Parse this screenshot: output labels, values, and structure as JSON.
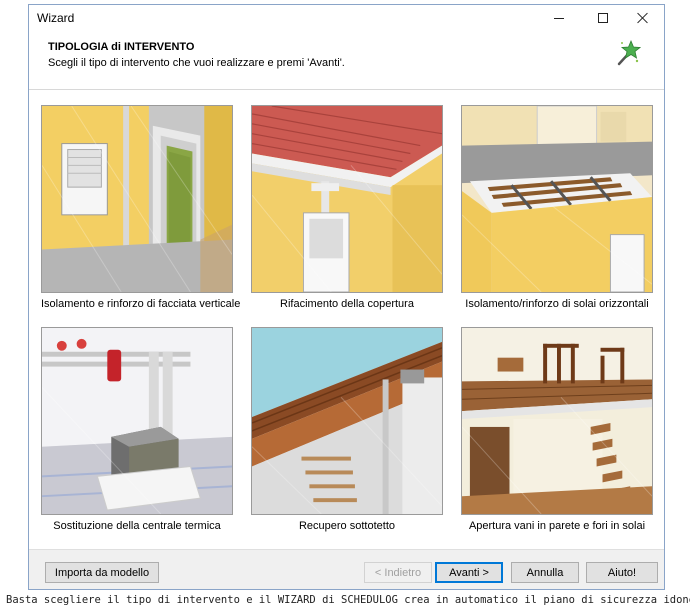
{
  "window": {
    "title": "Wizard"
  },
  "header": {
    "title": "TIPOLOGIA di INTERVENTO",
    "subtitle": "Scegli il tipo di intervento che vuoi realizzare e premi 'Avanti'."
  },
  "options": [
    {
      "label": "Isolamento e rinforzo di facciata verticale"
    },
    {
      "label": "Rifacimento della copertura"
    },
    {
      "label": "Isolamento/rinforzo di solai orizzontali"
    },
    {
      "label": "Sostituzione della centrale termica"
    },
    {
      "label": "Recupero sottotetto"
    },
    {
      "label": "Apertura vani in parete e fori in solai"
    }
  ],
  "footer": {
    "import_label": "Importa da modello",
    "back_label": "< Indietro",
    "next_label": "Avanti >",
    "cancel_label": "Annulla",
    "help_label": "Aiuto!"
  },
  "page_caption": "Basta scegliere il tipo di intervento e il WIZARD di SCHEDULOG crea in automatico il piano di sicurezza idoneo."
}
